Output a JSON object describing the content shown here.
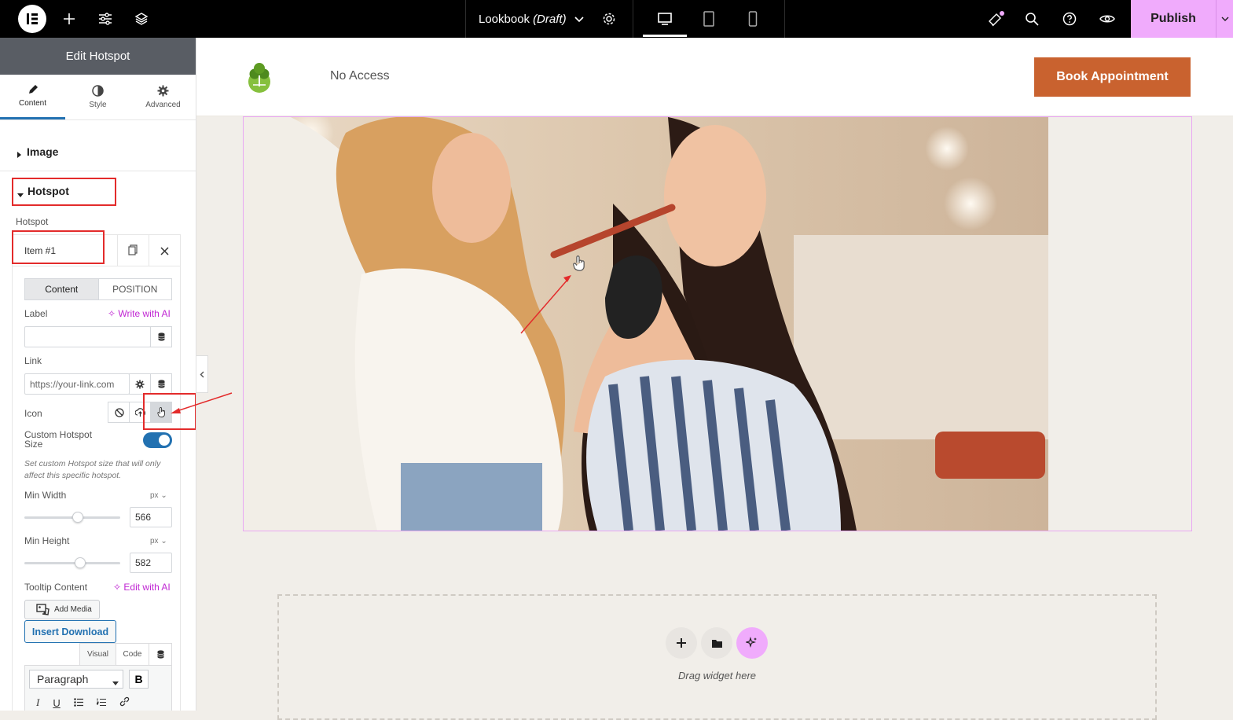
{
  "topbar": {
    "doc_name": "Lookbook",
    "doc_status": "(Draft)",
    "publish_label": "Publish"
  },
  "panel": {
    "title": "Edit Hotspot",
    "tabs": [
      {
        "label": "Content",
        "icon": "pencil-icon"
      },
      {
        "label": "Style",
        "icon": "contrast-icon"
      },
      {
        "label": "Advanced",
        "icon": "gear-icon"
      }
    ],
    "sections": {
      "image": "Image",
      "hotspot": "Hotspot"
    },
    "repeater_label": "Hotspot",
    "item_title": "Item #1",
    "inner_tabs": {
      "content": "Content",
      "position": "POSITION"
    },
    "label_field": {
      "label": "Label",
      "ai": "Write with AI",
      "value": ""
    },
    "link_field": {
      "label": "Link",
      "placeholder": "https://your-link.com"
    },
    "icon_field": {
      "label": "Icon"
    },
    "custom_size": {
      "label": "Custom Hotspot Size",
      "enabled": true,
      "help": "Set custom Hotspot size that will only affect this specific hotspot."
    },
    "min_width": {
      "label": "Min Width",
      "unit": "px",
      "value": "566"
    },
    "min_height": {
      "label": "Min Height",
      "unit": "px",
      "value": "582"
    },
    "tooltip": {
      "label": "Tooltip Content",
      "ai": "Edit with AI"
    },
    "editor": {
      "add_media": "Add Media",
      "insert_download": "Insert Download",
      "visual": "Visual",
      "code": "Code",
      "format": "Paragraph",
      "bold": "B"
    }
  },
  "canvas": {
    "nav_link": "No Access",
    "cta": "Book Appointment",
    "drop_text": "Drag widget here"
  },
  "colors": {
    "accent": "#c9622f",
    "publish": "#f0abfc",
    "ai": "#c026d3",
    "toggle": "#2271b1",
    "annotation": "#e32b2b"
  }
}
